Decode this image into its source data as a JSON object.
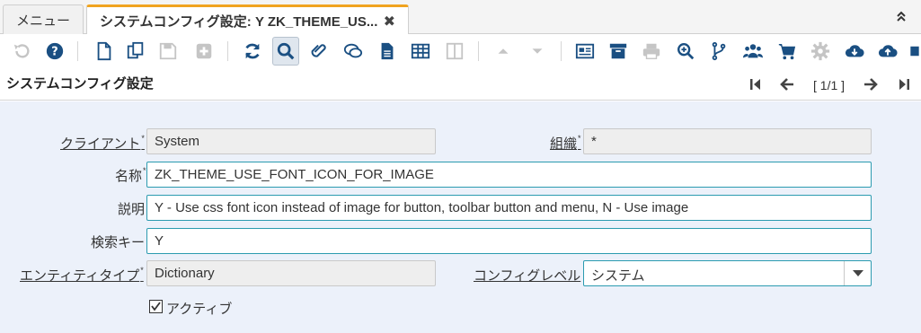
{
  "tabs": {
    "menu_label": "メニュー",
    "active_label": "システムコンフィグ設定: Y ZK_THEME_US...",
    "close_glyph": "✖",
    "collapse_glyph": "⌃⌃"
  },
  "toolbar": {
    "icons": [
      "undo-icon",
      "help-icon",
      "new-icon",
      "copy-icon",
      "save-icon",
      "add-icon",
      "refresh-icon",
      "find-icon",
      "attachment-icon",
      "chat-icon",
      "report-icon",
      "grid-icon",
      "split-icon",
      "up-icon",
      "down-icon",
      "archive-icon",
      "process-icon",
      "print-icon",
      "zoom-across-icon",
      "workflow-icon",
      "users-icon",
      "cart-icon",
      "settings-icon",
      "download-icon",
      "upload-icon"
    ]
  },
  "header": {
    "title": "システムコンフィグ設定",
    "record_indicator": "[ 1/1 ]"
  },
  "form": {
    "client_label": "クライアント",
    "client_value": "System",
    "org_label": "組織",
    "org_value": "*",
    "name_label": "名称",
    "name_value": "ZK_THEME_USE_FONT_ICON_FOR_IMAGE",
    "description_label": "説明",
    "description_value": "Y - Use css font icon instead of image for button, toolbar button and menu, N - Use image",
    "search_key_label": "検索キー",
    "search_key_value": "Y",
    "entity_type_label": "エンティティタイプ",
    "entity_type_value": "Dictionary",
    "config_level_label": "コンフィグレベル",
    "config_level_value": "システム",
    "active_label": "アクティブ",
    "active_checked": "☑",
    "required_mark": "*"
  },
  "colors": {
    "accent_tab": "#f0a31f",
    "icon_blue": "#1a4f82",
    "form_bg": "#ecf1fa",
    "edit_border": "#2b9bb0"
  }
}
